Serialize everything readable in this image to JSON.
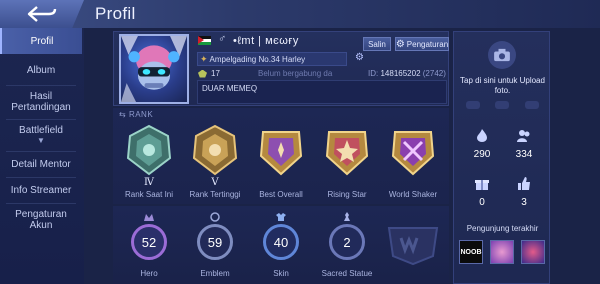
{
  "header": {
    "title": "Profil"
  },
  "sidebar": {
    "items": [
      {
        "label": "Profil",
        "active": true
      },
      {
        "label": "Album",
        "active": false
      },
      {
        "label": "Hasil\nPertandingan",
        "active": false
      },
      {
        "label": "Battlefield",
        "active": false,
        "chevron": true
      },
      {
        "label": "Detail Mentor",
        "active": false
      },
      {
        "label": "Info Streamer",
        "active": false
      },
      {
        "label": "Pengaturan\nAkun",
        "active": false
      }
    ]
  },
  "profile": {
    "player_name": "•ℓmt | мєωғу",
    "salin_label": "Salin",
    "pengaturan_label": "Pengaturan",
    "title_label": "Ampelgading No.34 Harley",
    "level": "17",
    "squad_status": "Belum bergabung da",
    "id_label": "ID:",
    "player_id": "148165202",
    "server": "(2742)",
    "bio": "DUAR MEMEQ"
  },
  "rank": {
    "heading": "RANK",
    "badges": [
      {
        "roman": "Ⅳ",
        "label": "Rank Saat Ini",
        "icon": "rank-current-icon",
        "color": "#6fa7a0"
      },
      {
        "roman": "Ⅴ",
        "label": "Rank Tertinggi",
        "icon": "rank-highest-icon",
        "color": "#c99a4a"
      },
      {
        "roman": "",
        "label": "Best Overall",
        "icon": "best-overall-icon",
        "color": "#d4a94e"
      },
      {
        "roman": "",
        "label": "Rising Star",
        "icon": "rising-star-icon",
        "color": "#d3a64e"
      },
      {
        "roman": "",
        "label": "World Shaker",
        "icon": "world-shaker-icon",
        "color": "#c994d8"
      }
    ]
  },
  "stats": [
    {
      "value": "52",
      "label": "Hero",
      "ring": "#9b6cd6"
    },
    {
      "value": "59",
      "label": "Emblem",
      "ring": "#8796c7"
    },
    {
      "value": "40",
      "label": "Skin",
      "ring": "#5f86d8"
    },
    {
      "value": "2",
      "label": "Sacred Statue",
      "ring": "#6b78b8"
    }
  ],
  "right_panel": {
    "upload_text": "Tap di sini untuk Upload foto.",
    "likes": "290",
    "followers": "334",
    "gifts": "0",
    "thumbs": "3",
    "recent_title": "Pengunjung terakhir",
    "recent_1_text": "NOOB"
  }
}
